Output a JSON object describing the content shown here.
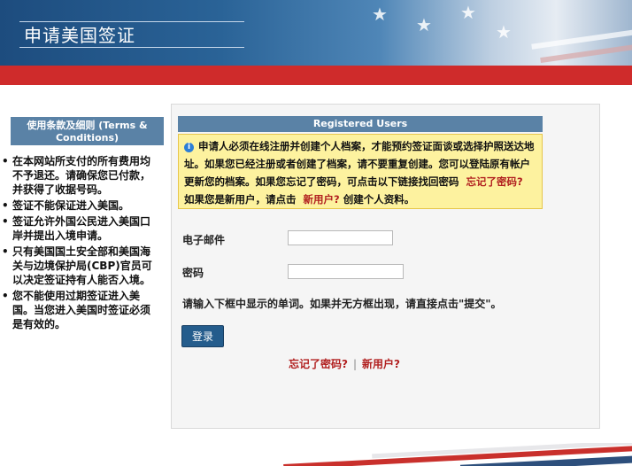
{
  "header": {
    "title": "申请美国签证"
  },
  "sidebar": {
    "heading": "使用条款及细则 (Terms & Conditions)",
    "items": [
      {
        "text": "在本网站所支付的所有费用均不予退还。请确保您已付款，并获得了收据号码。"
      },
      {
        "text": "签证不能保证进入美国。"
      },
      {
        "text": "签证允许外国公民进入美国口岸并提出入境申请。"
      },
      {
        "text": "只有美国国土安全部和美国海关与边境保护局(CBP)官员可以决定签证持有人能否入境。"
      },
      {
        "text": "您不能使用过期签证进入美国。当您进入美国时签证必须是有效的。"
      }
    ]
  },
  "login": {
    "heading": "Registered Users",
    "notice_text": "申请人必须在线注册并创建个人档案，才能预约签证面谈或选择护照送达地址。如果您已经注册或者创建了档案，请不要重复创建。您可以登陆原有帐户更新您的档案。如果您忘记了密码，可点击以下链接找回密码",
    "notice_forgot": "忘记了密码?",
    "notice_middle": "如果您是新用户，请点击",
    "notice_new_user": "新用户?",
    "notice_end": "创建个人资料。",
    "email_label": "电子邮件",
    "email_value": "",
    "password_label": "密码",
    "password_value": "",
    "captcha_hint": "请输入下框中显示的单词。如果并无方框出现，请直接点击\"提交\"。",
    "login_button": "登录",
    "forgot_link": "忘记了密码?",
    "new_user_link": "新用户?",
    "separator": "|"
  },
  "colors": {
    "header_blue": "#1d4c7e",
    "header_red": "#cf2b2b",
    "section_head": "#5a82a6",
    "notice_bg": "#fdf29f",
    "link_red": "#b11f1f",
    "button_blue": "#245c8c"
  },
  "icons": {
    "notice": "info-icon",
    "list_bullet": "bullet-dot"
  }
}
